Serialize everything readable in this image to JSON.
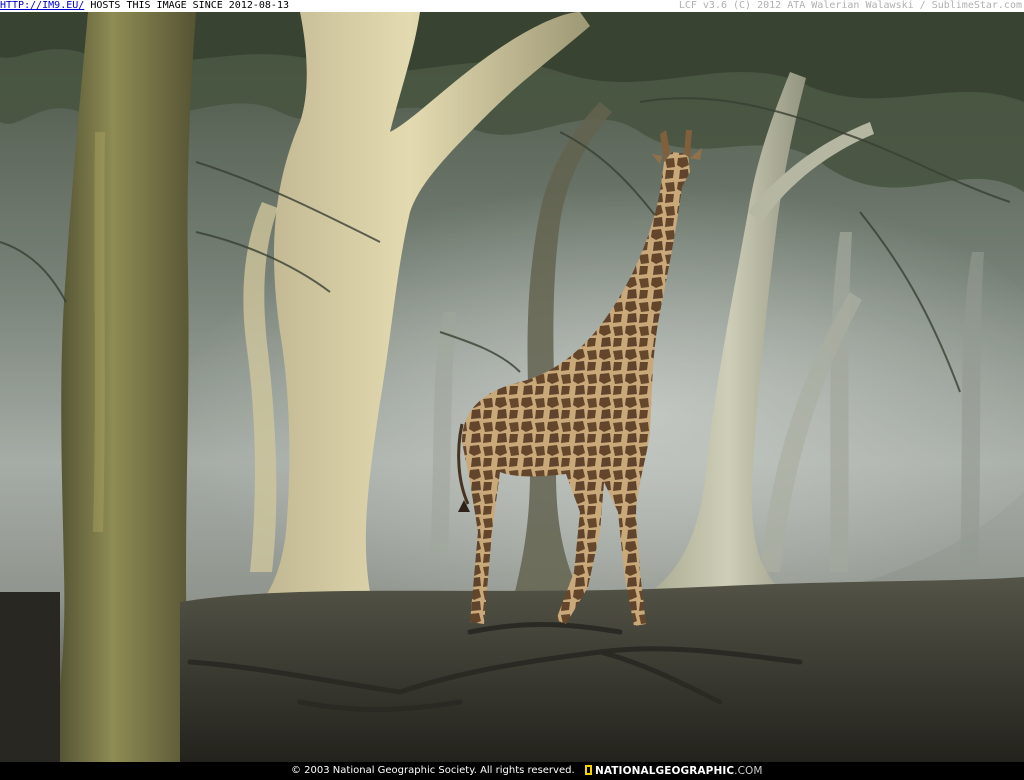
{
  "topbar": {
    "link_text": "HTTP://IM9.EU/",
    "hosts_text": " HOSTS THIS IMAGE SINCE 2012-08-13",
    "right_text": "LCF v3.6 (C) 2012 ATA Walerian Walawski / SublimeStar.com"
  },
  "footer": {
    "copyright": "© 2003 National Geographic Society. All rights reserved.",
    "brand": "NATIONALGEOGRAPHIC",
    "brand_suffix": ".COM"
  },
  "colors": {
    "link": "#0000cc",
    "brand_yellow": "#f7d300"
  }
}
